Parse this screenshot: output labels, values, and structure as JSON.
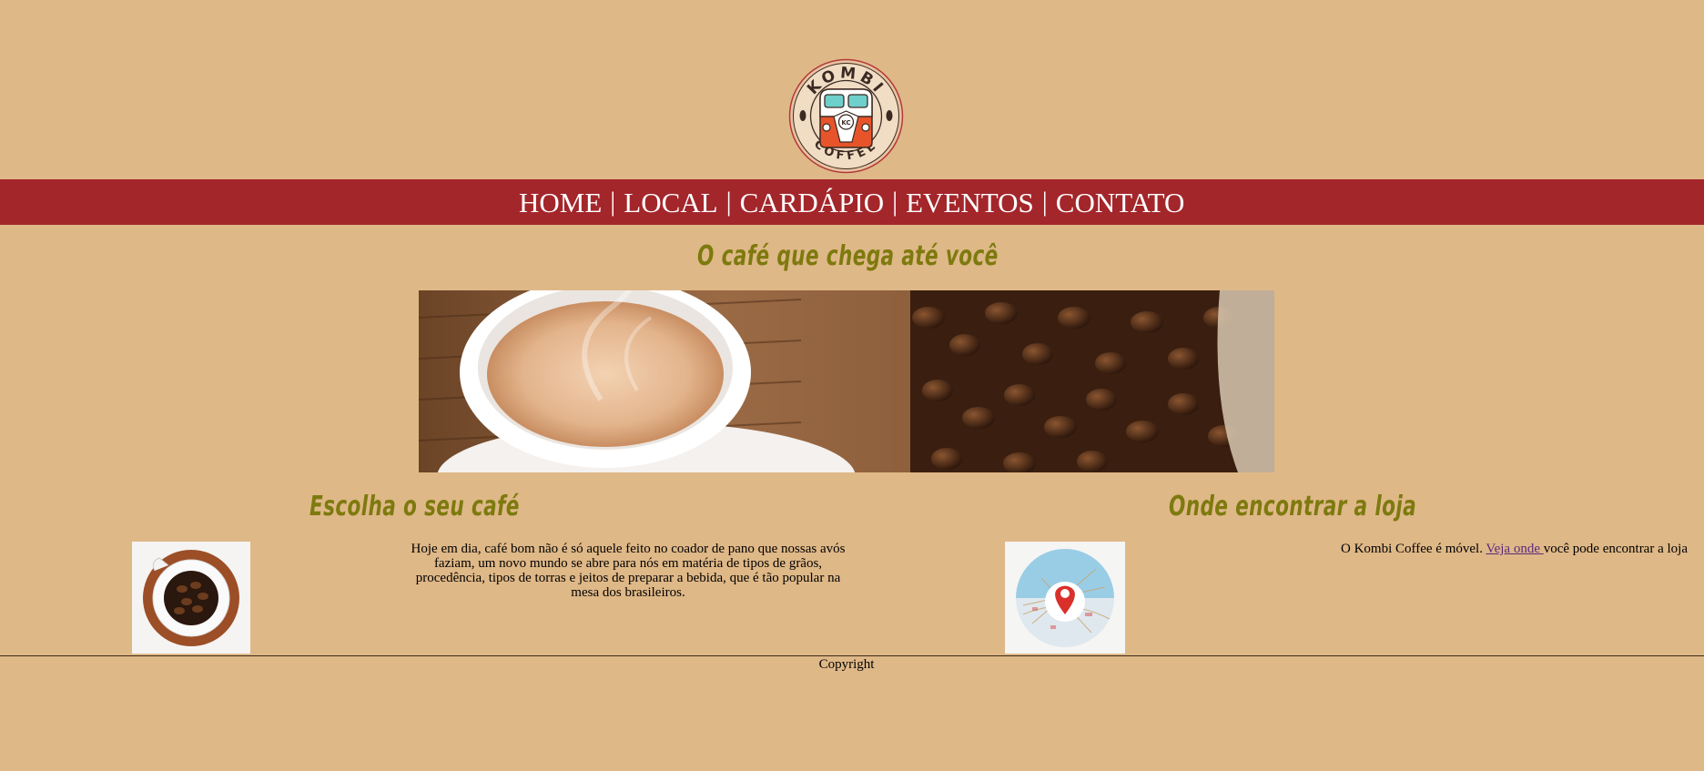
{
  "logo": {
    "name_top": "KOMBI",
    "name_bottom": "COFFEE",
    "badge": "KC",
    "icon": "kombi-van-logo"
  },
  "nav": {
    "items": [
      {
        "label": "HOME"
      },
      {
        "label": "LOCAL"
      },
      {
        "label": "CARDÁPIO"
      },
      {
        "label": "EVENTOS"
      },
      {
        "label": "CONTATO"
      }
    ],
    "separator": "|",
    "background": "#A3262B"
  },
  "main": {
    "title": "O café que chega até você",
    "hero_image": "coffee-cup-and-beans-banner"
  },
  "choose": {
    "title": "Escolha o seu café",
    "image": "coffee-beans-in-cup-photo",
    "text": "Hoje em dia, café bom não é só aquele feito no coador de pano que nossas avós faziam, um novo mundo se abre para nós em matéria de tipos de grãos, procedência, tipos de torras e jeitos de preparar a bebida, que é tão popular na mesa dos brasileiros."
  },
  "find": {
    "title": "Onde encontrar a loja",
    "image": "map-pin-icon",
    "text_before": "O Kombi Coffee é móvel. ",
    "link_label": "Veja onde ",
    "text_after": "você pode encontrar a loja"
  },
  "footer": {
    "text": "Copyright"
  },
  "colors": {
    "page_background": "#DFB887",
    "title_color": "#7D7A0E",
    "link_color": "#5B2A7B"
  }
}
